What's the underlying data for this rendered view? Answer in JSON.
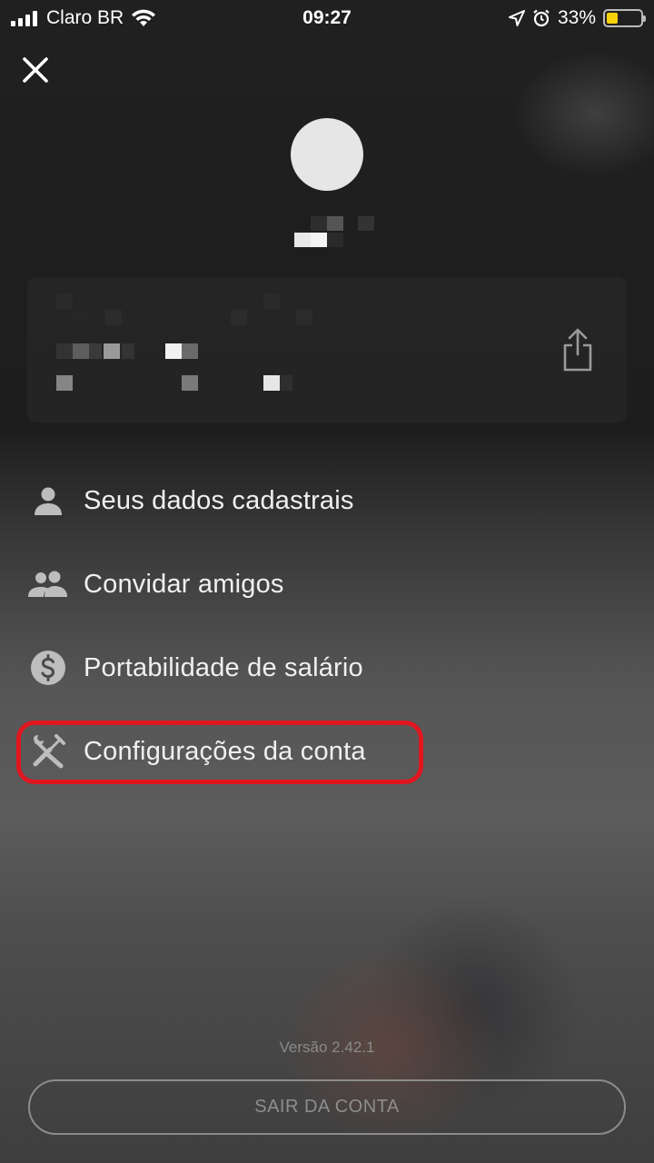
{
  "status_bar": {
    "carrier": "Claro BR",
    "time": "09:27",
    "battery_percent": "33%",
    "battery_level": 0.33,
    "battery_color": "#f5d10a",
    "icons": [
      "signal-icon",
      "wifi-icon",
      "location-arrow-icon",
      "alarm-icon",
      "battery-icon"
    ]
  },
  "header": {
    "close_icon": "close-icon",
    "share_icon": "share-icon"
  },
  "menu": {
    "items": [
      {
        "label": "Seus dados cadastrais",
        "icon": "person-icon"
      },
      {
        "label": "Convidar amigos",
        "icon": "people-icon"
      },
      {
        "label": "Portabilidade de salário",
        "icon": "dollar-circle-icon"
      },
      {
        "label": "Configurações da conta",
        "icon": "tools-icon",
        "highlighted": true
      }
    ]
  },
  "footer": {
    "version": "Versão 2.42.1",
    "logout_label": "SAIR DA CONTA"
  },
  "colors": {
    "highlight": "#e0161f",
    "text": "#f0f0f0",
    "muted": "#8e8e8e"
  }
}
